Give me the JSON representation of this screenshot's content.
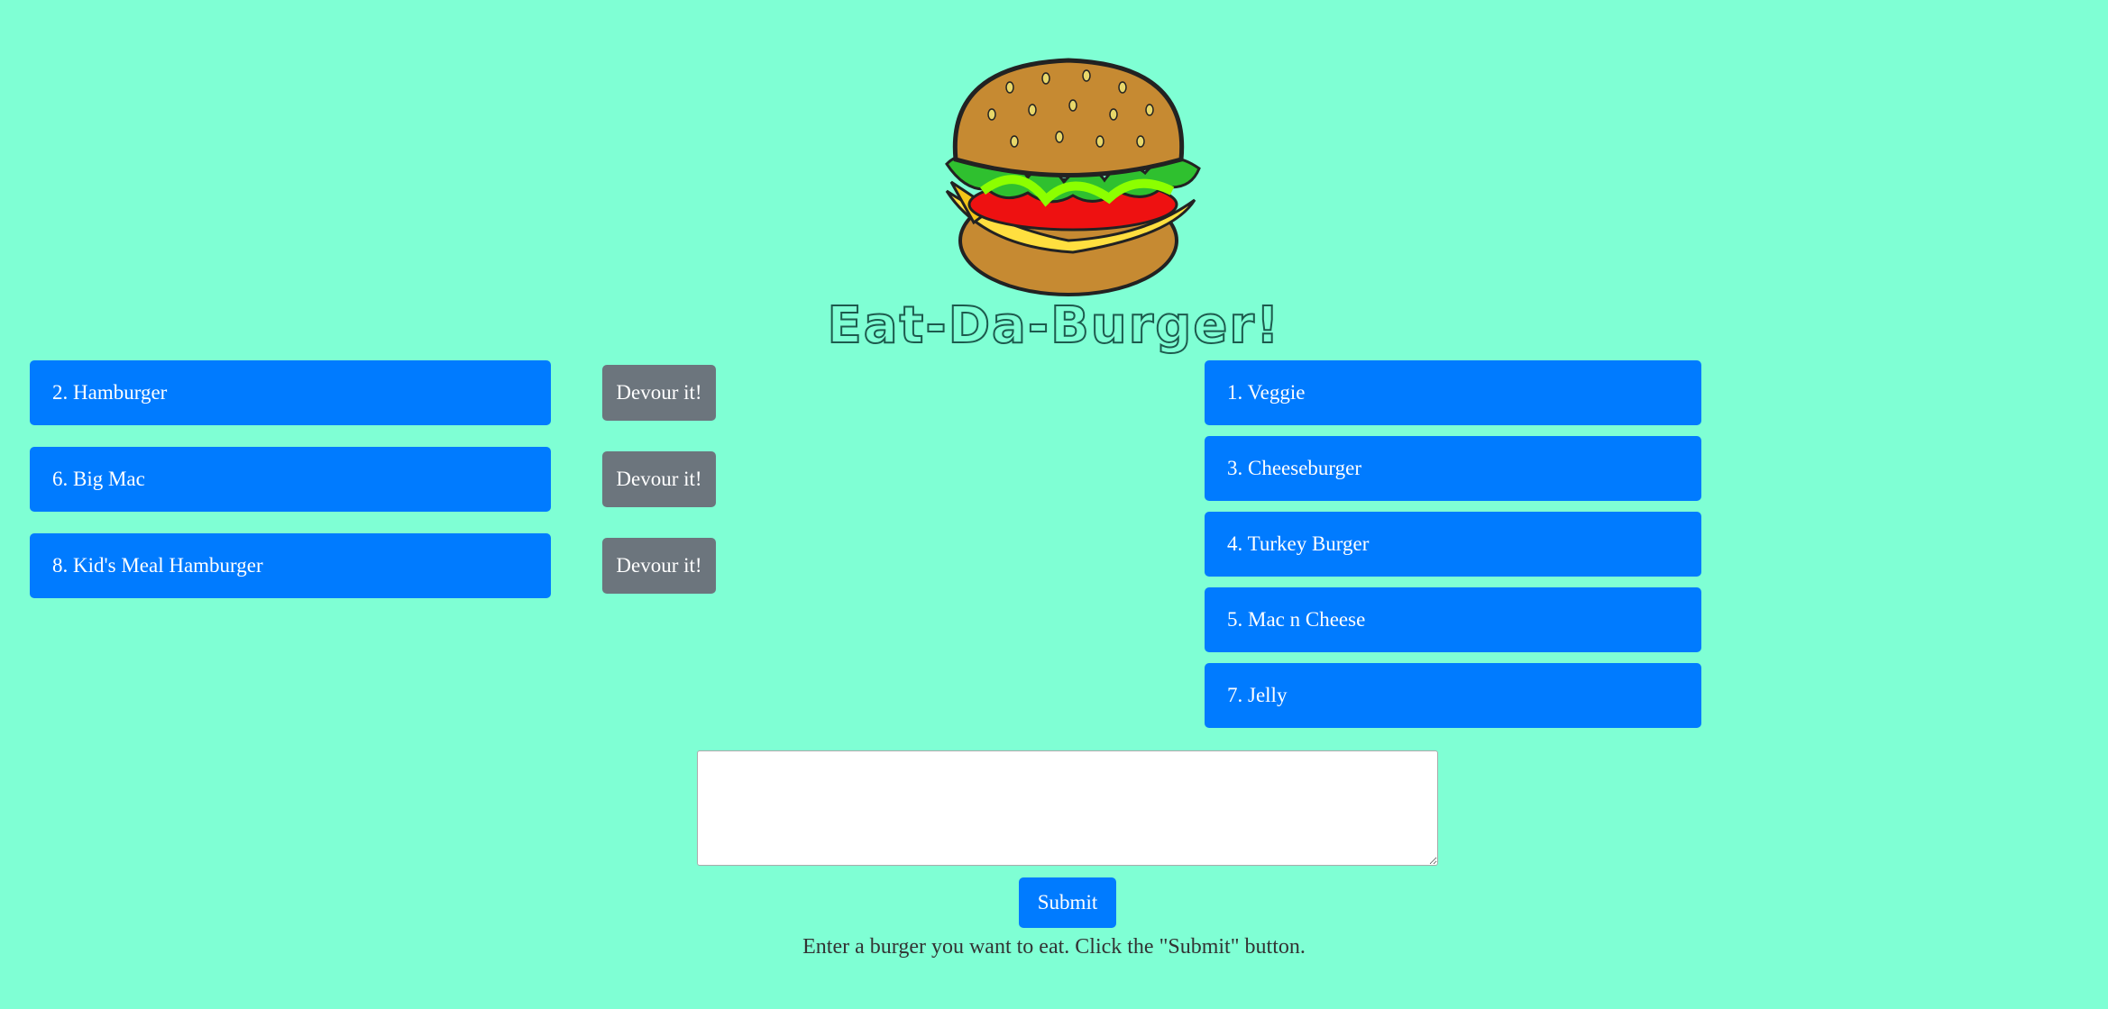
{
  "header": {
    "title": "Eat-Da-Burger!",
    "logo_icon": "burger-icon"
  },
  "uneaten": {
    "items": [
      {
        "label": "2. Hamburger",
        "button": "Devour it!"
      },
      {
        "label": "6. Big Mac",
        "button": "Devour it!"
      },
      {
        "label": "8. Kid's Meal Hamburger",
        "button": "Devour it!"
      }
    ]
  },
  "devoured": {
    "items": [
      {
        "label": "1. Veggie"
      },
      {
        "label": "3. Cheeseburger"
      },
      {
        "label": "4. Turkey Burger"
      },
      {
        "label": "5. Mac n Cheese"
      },
      {
        "label": "7. Jelly"
      }
    ]
  },
  "form": {
    "input_value": "",
    "submit_label": "Submit",
    "hint": "Enter a burger you want to eat. Click the \"Submit\" button."
  },
  "colors": {
    "background": "#7fffd4",
    "primary": "#007bff",
    "secondary": "#6c757d"
  }
}
